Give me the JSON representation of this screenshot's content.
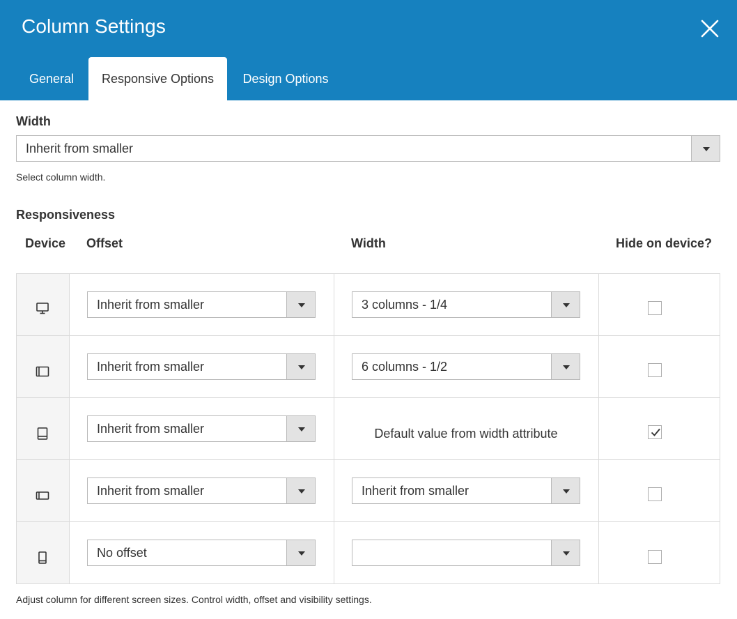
{
  "header": {
    "title": "Column Settings",
    "close_icon": "close-icon",
    "tabs": [
      {
        "label": "General",
        "active": false
      },
      {
        "label": "Responsive Options",
        "active": true
      },
      {
        "label": "Design Options",
        "active": false
      }
    ]
  },
  "width_field": {
    "label": "Width",
    "value": "Inherit from smaller",
    "help": "Select column width."
  },
  "responsiveness": {
    "label": "Responsiveness",
    "headers": {
      "device": "Device",
      "offset": "Offset",
      "width": "Width",
      "hide": "Hide on device?"
    },
    "rows": [
      {
        "device_icon": "desktop-icon",
        "offset": "Inherit from smaller",
        "width": "3 columns - 1/4",
        "width_is_select": true,
        "hidden": false
      },
      {
        "device_icon": "tablet-landscape-icon",
        "offset": "Inherit from smaller",
        "width": "6 columns - 1/2",
        "width_is_select": true,
        "hidden": false
      },
      {
        "device_icon": "tablet-portrait-icon",
        "offset": "Inherit from smaller",
        "width": "Default value from width attribute",
        "width_is_select": false,
        "hidden": true
      },
      {
        "device_icon": "mobile-landscape-icon",
        "offset": "Inherit from smaller",
        "width": "Inherit from smaller",
        "width_is_select": true,
        "hidden": false
      },
      {
        "device_icon": "mobile-portrait-icon",
        "offset": "No offset",
        "width": "",
        "width_is_select": true,
        "hidden": false
      }
    ],
    "help": "Adjust column for different screen sizes. Control width, offset and visibility settings."
  },
  "colors": {
    "header_bg": "#1681bf",
    "text": "#333333",
    "border": "#dadada"
  }
}
